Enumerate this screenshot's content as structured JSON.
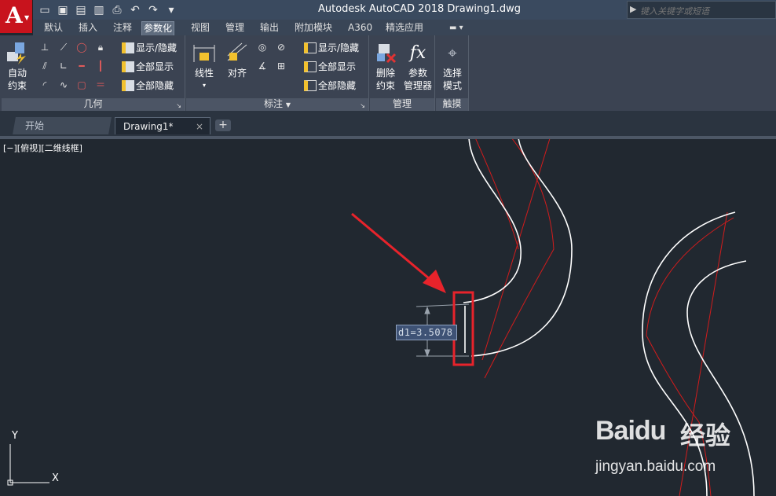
{
  "title_bar": {
    "title": "Autodesk AutoCAD 2018    Drawing1.dwg",
    "search_placeholder": "键入关键字或短语",
    "app_letter": "A",
    "qat_icons": [
      "new-icon",
      "open-icon",
      "save-icon",
      "saveas-icon",
      "print-icon",
      "undo-icon",
      "redo-icon",
      "dropdown-icon"
    ]
  },
  "ribbon_tabs": [
    "默认",
    "插入",
    "注释",
    "参数化",
    "视图",
    "管理",
    "输出",
    "附加模块",
    "A360",
    "精选应用"
  ],
  "active_tab": "参数化",
  "panels": {
    "geometry": {
      "title": "几何",
      "auto_constrain": [
        "自动",
        "约束"
      ],
      "show_hide": "显示/隐藏",
      "show_all": "全部显示",
      "hide_all": "全部隐藏"
    },
    "dimension": {
      "title": "标注",
      "linear": "线性",
      "aligned": "对齐",
      "show_hide": "显示/隐藏",
      "show_all": "全部显示",
      "hide_all": "全部隐藏"
    },
    "manage": {
      "title": "管理",
      "delete_constraints": [
        "删除",
        "约束"
      ],
      "param_manager": [
        "参数",
        "管理器"
      ]
    },
    "capture": {
      "title": "触摸",
      "select_mode": [
        "选择",
        "模式"
      ]
    }
  },
  "doc_tabs": {
    "start": "开始",
    "drawing": "Drawing1*",
    "close": "×",
    "add": "+"
  },
  "viewport": {
    "label": "[−][俯视][二维线框]",
    "dimension_value": "d1=3.5078",
    "ucs_y": "Y",
    "ucs_x": "X"
  },
  "watermark": {
    "logo": "Baidu",
    "brand_cn": "经验",
    "url": "jingyan.baidu.com"
  },
  "colors": {
    "canvas": "#212830",
    "annotation_red": "#e8232b",
    "construction_red": "#d21c1c",
    "ribbon": "#3b4352"
  }
}
